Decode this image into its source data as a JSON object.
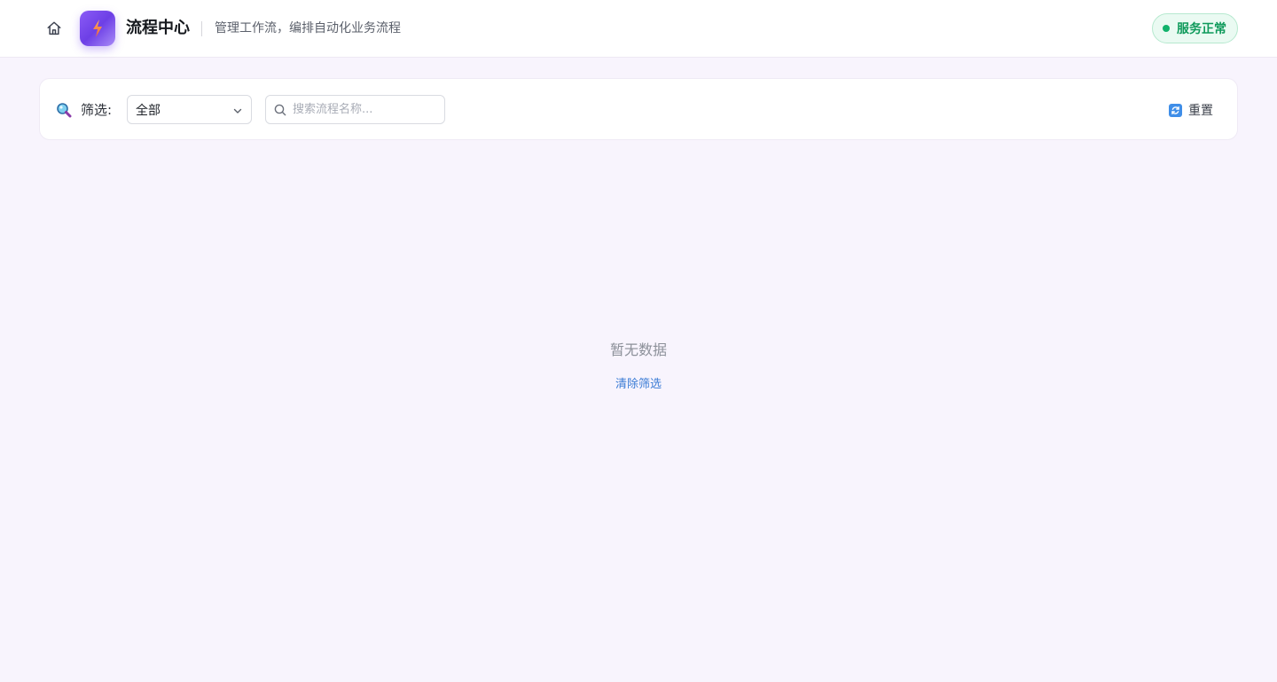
{
  "header": {
    "app_title": "流程中心",
    "subtitle": "管理工作流，编排自动化业务流程",
    "status": {
      "text": "服务正常",
      "color": "#11b26b"
    },
    "home_icon": "home-icon",
    "logo_icon": "lightning-icon"
  },
  "filter_bar": {
    "label": "筛选:",
    "filter_icon": "magnifier-icon",
    "category_select": {
      "value": "全部"
    },
    "search": {
      "placeholder": "搜索流程名称...",
      "value": ""
    },
    "reset_label": "重置"
  },
  "empty_state": {
    "message": "暂无数据",
    "clear_link": "清除筛选"
  },
  "colors": {
    "accent": "#7c4df0",
    "page_bg": "#f8f4fd",
    "link": "#3a7bd5",
    "success": "#11b26b"
  }
}
